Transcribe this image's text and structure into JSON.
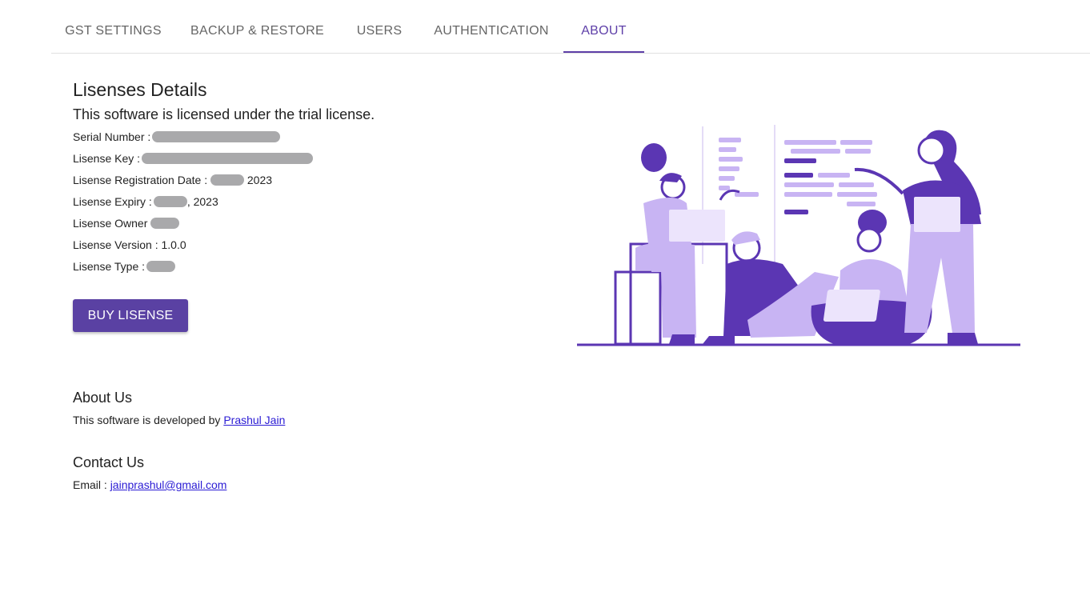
{
  "tabs": [
    {
      "label": "GST SETTINGS",
      "active": false
    },
    {
      "label": "BACKUP & RESTORE",
      "active": false
    },
    {
      "label": "USERS",
      "active": false
    },
    {
      "label": "AUTHENTICATION",
      "active": false
    },
    {
      "label": "ABOUT",
      "active": true
    }
  ],
  "license": {
    "title": "Lisenses Details",
    "subtitle": "This software is licensed under the trial license.",
    "serial_label": "Serial Number :",
    "key_label": "Lisense Key :",
    "registration_label": "Lisense Registration Date :",
    "registration_year": "2023",
    "expiry_label": "Lisense Expiry :",
    "expiry_suffix": ", 2023",
    "owner_label": "Lisense Owner",
    "version_label": "Lisense Version : 1.0.0",
    "type_label": "Lisense Type :",
    "buy_button": "BUY LISENSE"
  },
  "about": {
    "title": "About Us",
    "text": "This software is developed by ",
    "link": "Prashul Jain"
  },
  "contact": {
    "title": "Contact Us",
    "email_label": "Email : ",
    "email": "jainprashul@gmail.com"
  },
  "colors": {
    "accent": "#5a41a3",
    "illustration_dark": "#5b36b3",
    "illustration_light": "#c8b4f3"
  }
}
